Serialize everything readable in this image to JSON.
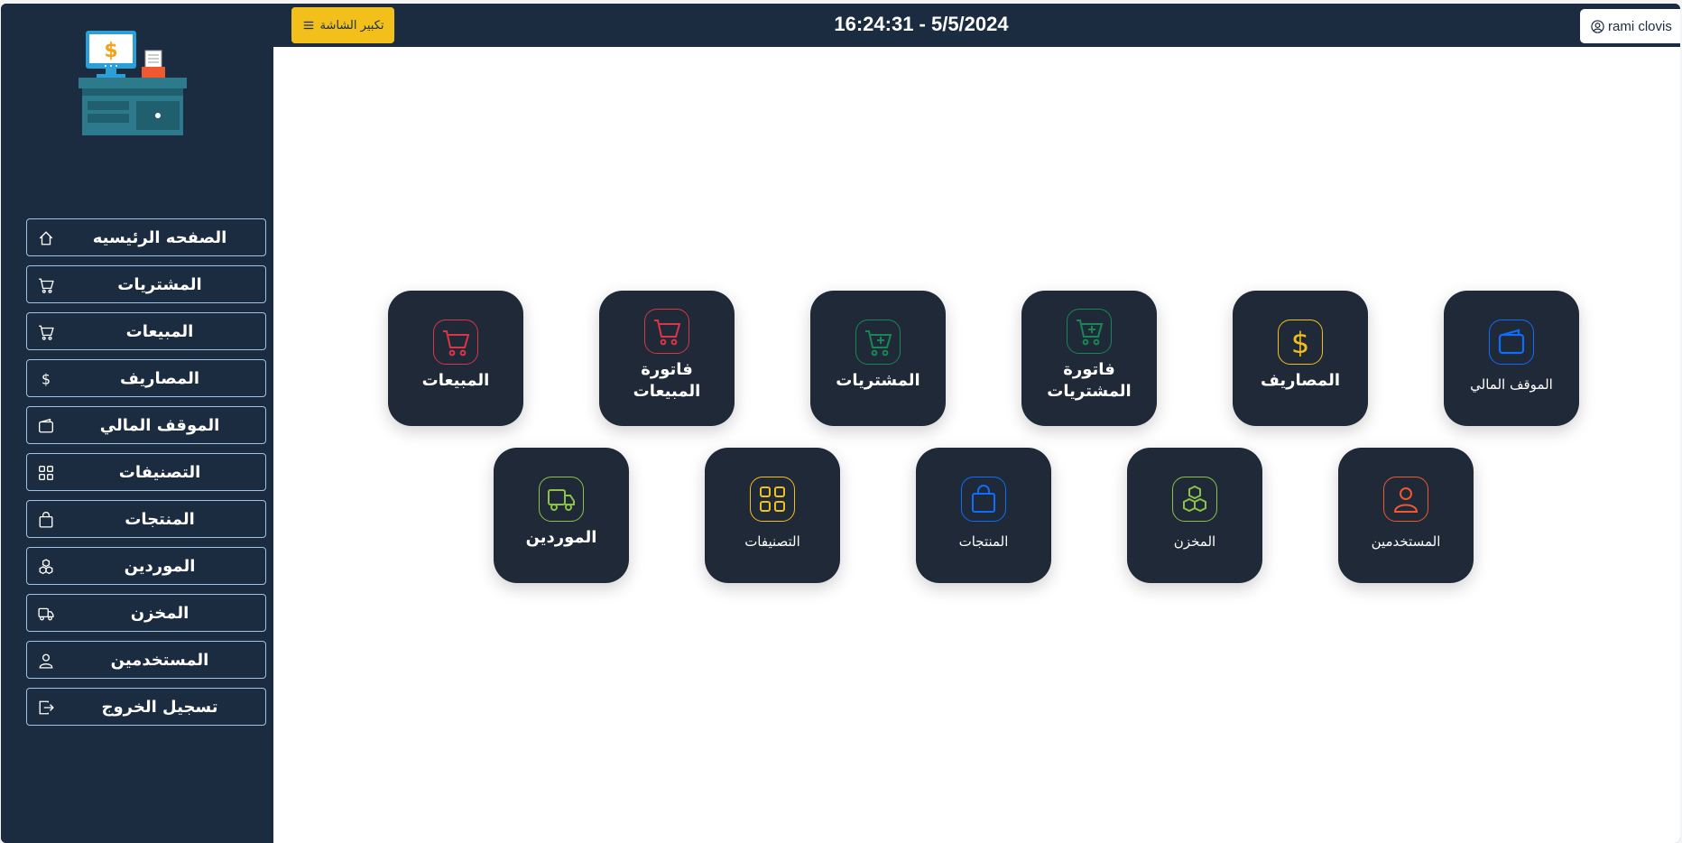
{
  "header": {
    "fullscreen_label": "تكبير الشاشة",
    "datetime": "16:24:31 - 5/5/2024",
    "user_name": "rami clovis"
  },
  "sidebar": {
    "items": [
      {
        "label": "الصفحه الرئيسيه",
        "icon": "house-icon"
      },
      {
        "label": "المشتريات",
        "icon": "cart-icon"
      },
      {
        "label": "المبيعات",
        "icon": "cart-icon"
      },
      {
        "label": "المصاريف",
        "icon": "dollar-icon"
      },
      {
        "label": "الموقف المالي",
        "icon": "wallet-icon"
      },
      {
        "label": "التصنيفات",
        "icon": "grid-icon"
      },
      {
        "label": "المنتجات",
        "icon": "bag-icon"
      },
      {
        "label": "الموردين",
        "icon": "boxes-icon"
      },
      {
        "label": "المخزن",
        "icon": "truck-icon"
      },
      {
        "label": "المستخدمين",
        "icon": "person-icon"
      },
      {
        "label": "تسجيل الخروج",
        "icon": "logout-icon"
      }
    ]
  },
  "tiles": [
    {
      "label": "المبيعات",
      "icon": "cart-icon",
      "color": "#dc3545"
    },
    {
      "label": "فاتورة المبيعات",
      "icon": "cart-icon",
      "color": "#dc3545"
    },
    {
      "label": "المشتريات",
      "icon": "cart-plus-icon",
      "color": "#198754"
    },
    {
      "label": "فاتورة المشتريات",
      "icon": "cart-plus-icon",
      "color": "#198754"
    },
    {
      "label": "المصاريف",
      "icon": "dollar-icon",
      "color": "#f3c01b"
    },
    {
      "label": "الموقف المالي",
      "icon": "wallet-icon",
      "color": "#0d6efd"
    },
    {
      "label": "الموردين",
      "icon": "truck-icon",
      "color": "#8bc34a"
    },
    {
      "label": "التصنيفات",
      "icon": "grid-icon",
      "color": "#f3c01b"
    },
    {
      "label": "المنتجات",
      "icon": "bag-icon",
      "color": "#0d6efd"
    },
    {
      "label": "المخزن",
      "icon": "boxes-icon",
      "color": "#8bc34a"
    },
    {
      "label": "المستخدمين",
      "icon": "person-icon",
      "color": "#f0582f"
    }
  ]
}
